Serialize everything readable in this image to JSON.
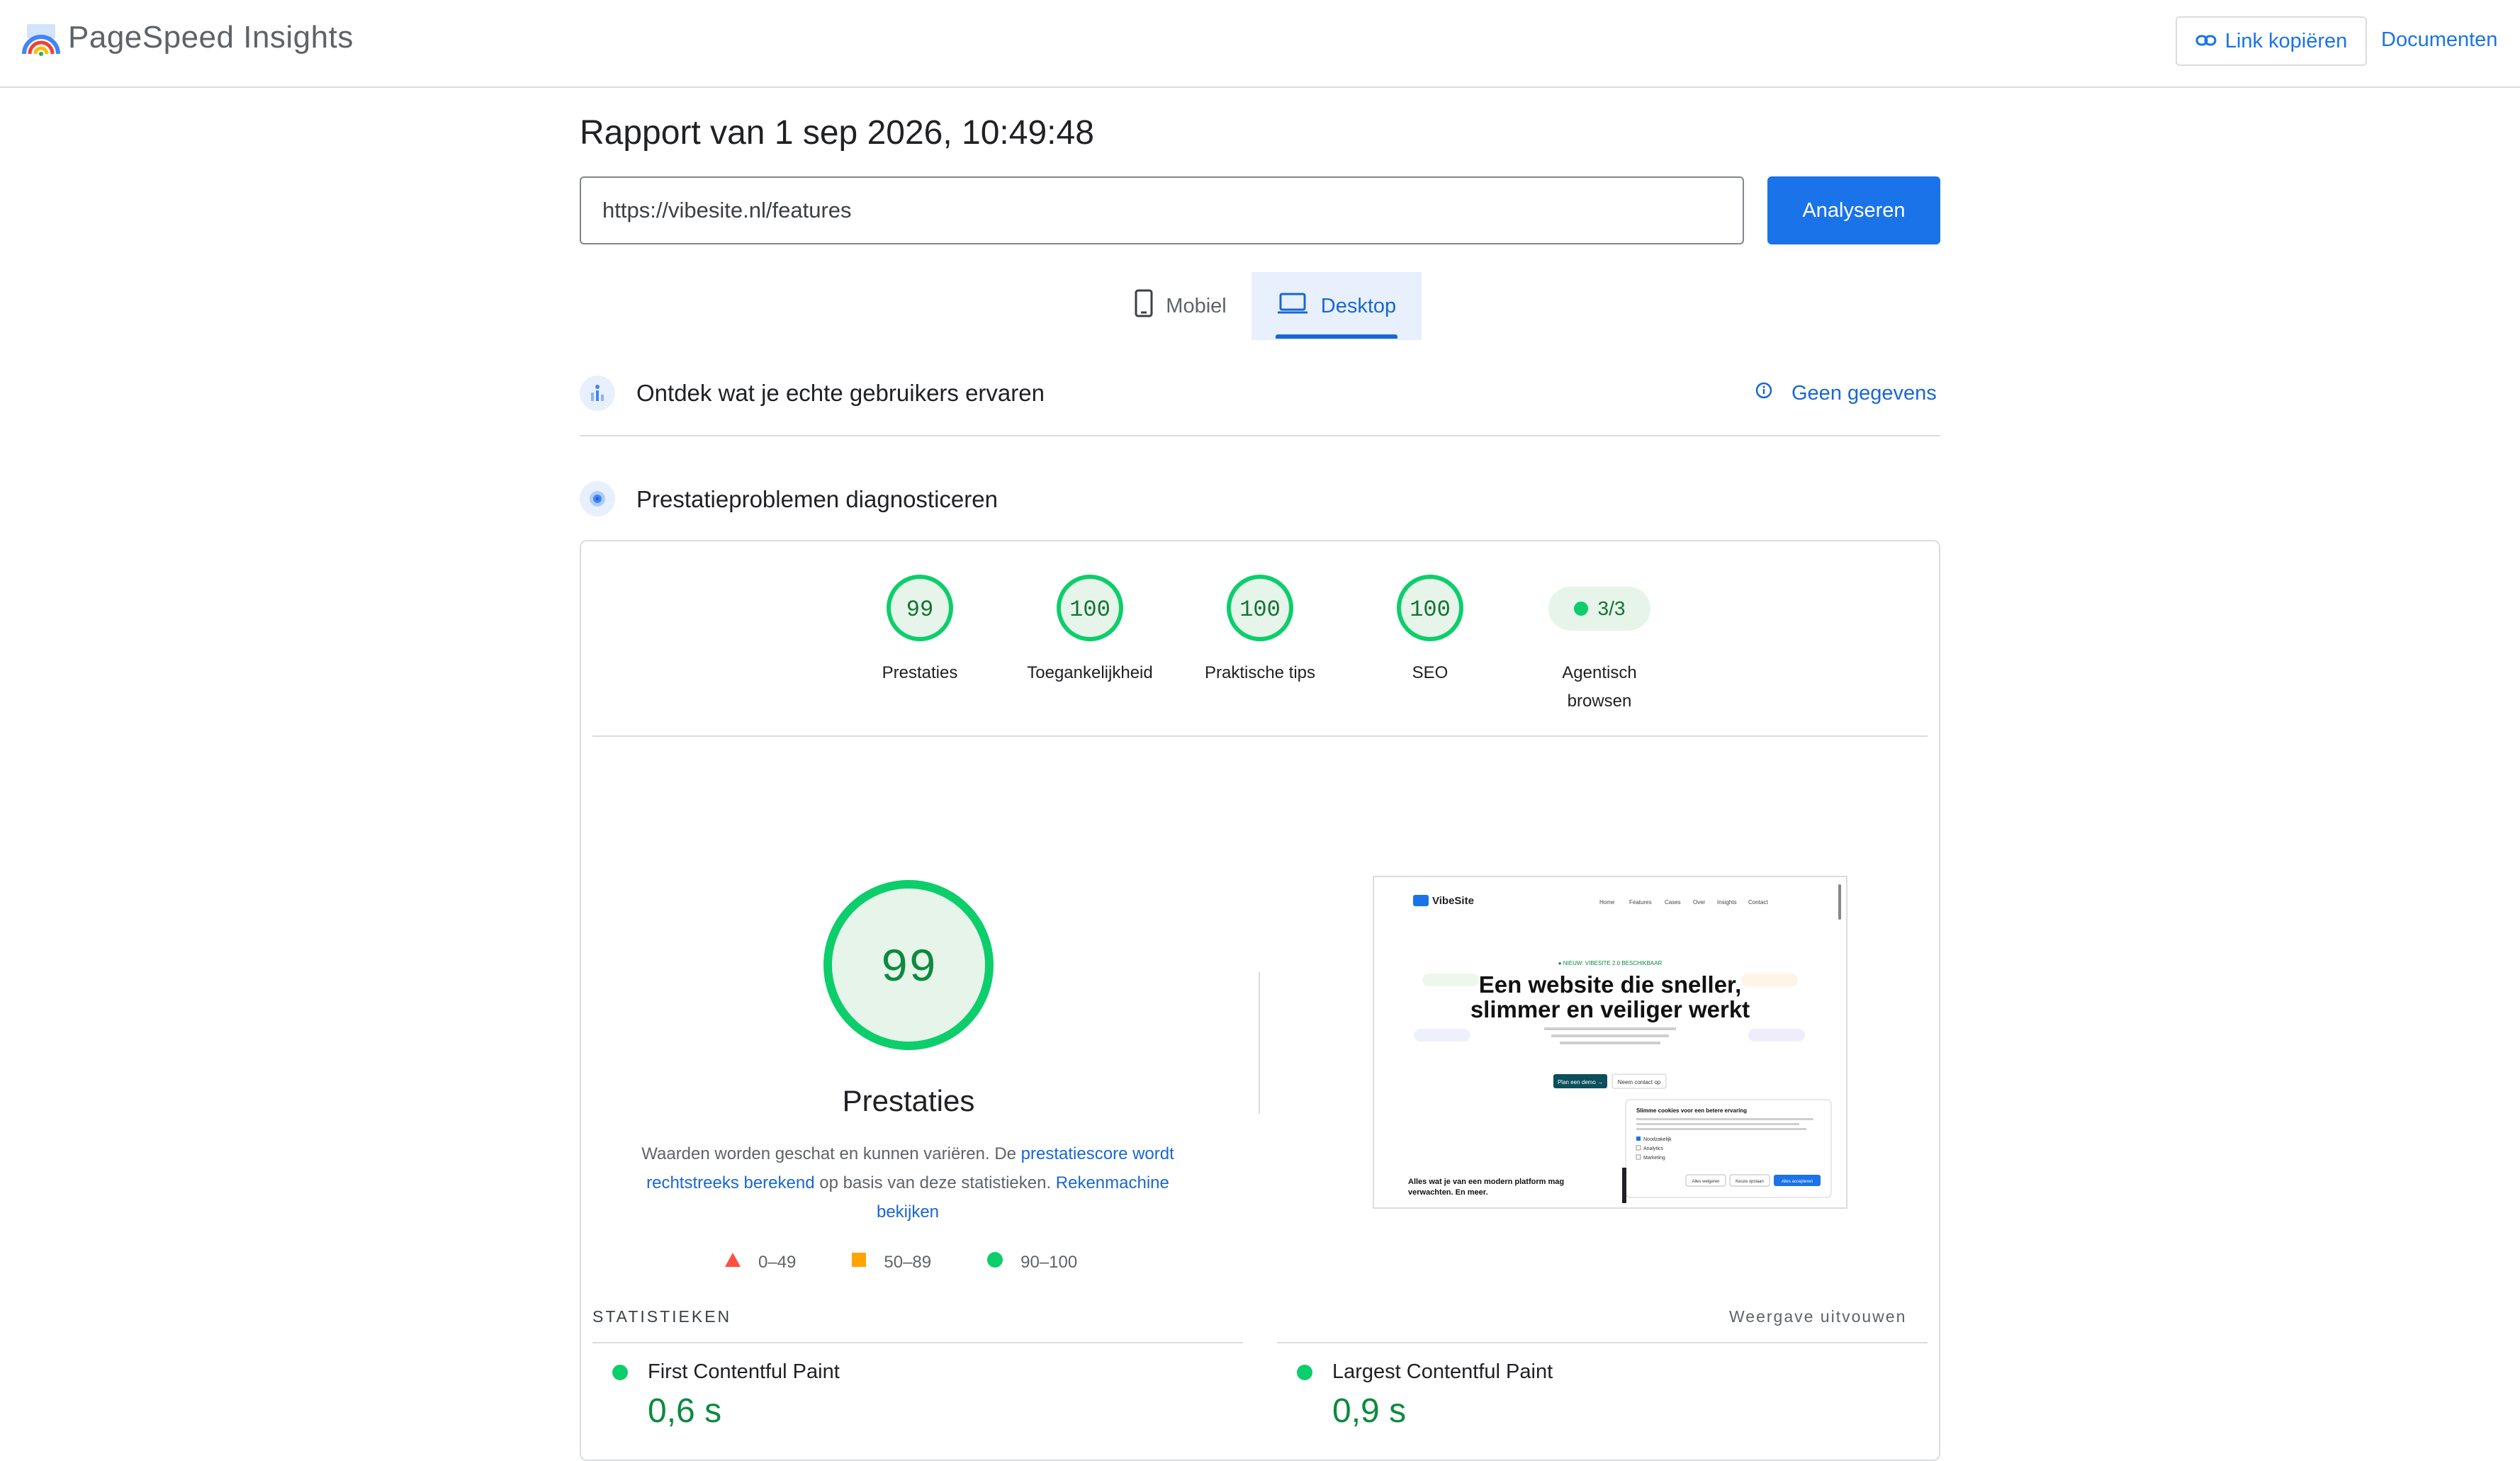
{
  "header": {
    "app_title": "PageSpeed Insights",
    "copy_link_label": "Link kopiëren",
    "docs_label": "Documenten"
  },
  "report": {
    "title": "Rapport van 1 sep 2026, 10:49:48",
    "url": "https://vibesite.nl/features",
    "analyze_label": "Analyseren"
  },
  "tabs": [
    {
      "label": "Mobiel",
      "icon": "phone-icon",
      "selected": false
    },
    {
      "label": "Desktop",
      "icon": "laptop-icon",
      "selected": true
    }
  ],
  "field_data": {
    "title": "Ontdek wat je echte gebruikers ervaren",
    "status": "Geen gegevens"
  },
  "lab": {
    "title": "Prestatieproblemen diagnosticeren",
    "categories": [
      {
        "score": "99",
        "label": "Prestaties"
      },
      {
        "score": "100",
        "label": "Toegankelijkheid"
      },
      {
        "score": "100",
        "label": "Praktische tips"
      },
      {
        "score": "100",
        "label": "SEO"
      }
    ],
    "agentic": {
      "value": "3/3",
      "label_line1": "Agentisch",
      "label_line2": "browsen"
    },
    "performance": {
      "score": "99",
      "label": "Prestaties",
      "desc_text1": "Waarden worden geschat en kunnen variëren. De ",
      "desc_link1": "prestatiescore wordt rechtstreeks berekend",
      "desc_text2": " op basis van deze statistieken. ",
      "desc_link2": "Rekenmachine bekijken"
    },
    "legend": [
      {
        "range": "0–49",
        "color": "#ff4e42",
        "shape": "triangle"
      },
      {
        "range": "50–89",
        "color": "#ffa400",
        "shape": "square"
      },
      {
        "range": "90–100",
        "color": "#0cce6b",
        "shape": "circle"
      }
    ],
    "screenshot": {
      "brand": "VibeSite",
      "nav": [
        "Home",
        "Features",
        "Cases",
        "Over",
        "Insights",
        "Contact"
      ],
      "eyebrow": "● NIEUW: VIBESITE 2.0 BESCHIKBAAR",
      "headline_1": "Een website die sneller,",
      "headline_2": "slimmer en veiliger werkt",
      "cta_primary": "Plan een demo →",
      "cta_secondary": "Neem contact op",
      "footer_text_1": "Alles wat je van een modern platform mag",
      "footer_text_2": "verwachten. En meer.",
      "cookie_title": "Slimme cookies voor een betere ervaring",
      "cookie_options": [
        "Noodzakelijk",
        "Analytics",
        "Marketing"
      ],
      "cookie_buttons": [
        "Alles weigeren",
        "Keuze opslaan",
        "Alles accepteren"
      ]
    },
    "statistics": {
      "label": "STATISTIEKEN",
      "expand_label": "Weergave uitvouwen",
      "metrics": [
        {
          "name": "First Contentful Paint",
          "value": "0,6 s"
        },
        {
          "name": "Largest Contentful Paint",
          "value": "0,9 s"
        }
      ]
    }
  },
  "colors": {
    "pass": "#0cce6b",
    "accent": "#1a73e8"
  }
}
